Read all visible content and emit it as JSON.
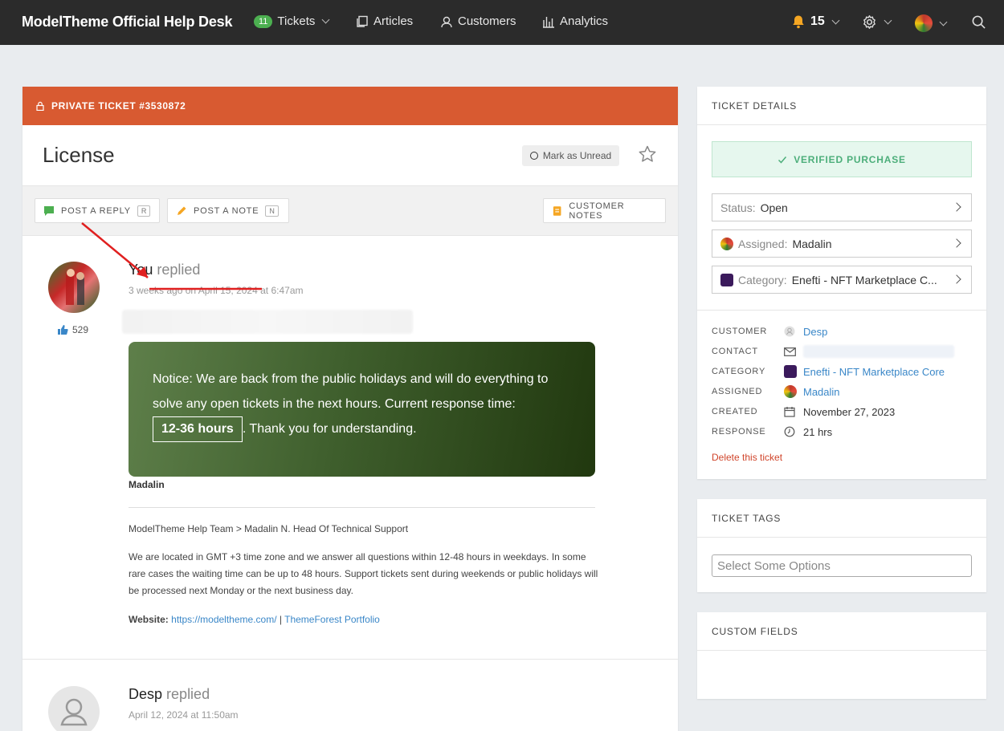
{
  "nav": {
    "brand": "ModelTheme Official Help Desk",
    "tickets_count": "11",
    "tickets_label": "Tickets",
    "articles_label": "Articles",
    "customers_label": "Customers",
    "analytics_label": "Analytics",
    "notifications_count": "15"
  },
  "ticket": {
    "private_label": "PRIVATE TICKET #3530872",
    "title": "License",
    "mark_unread_label": "Mark as Unread",
    "post_reply_label": "POST A REPLY",
    "post_reply_key": "R",
    "post_note_label": "POST A NOTE",
    "post_note_key": "N",
    "customer_notes_label": "CUSTOMER NOTES"
  },
  "replies": [
    {
      "author": "You",
      "action": "replied",
      "date": "3 weeks ago on April 15, 2024 at 6:47am",
      "likes": "529",
      "notice_text_1": "Notice: We are back from the public holidays and will do everything to solve any open tickets in the next hours. Current response time:",
      "notice_hours": "12-36 hours",
      "notice_text_2": ". Thank you for understanding.",
      "signature_name": "Madalin",
      "signature_team": "ModelTheme Help Team > Madalin N. Head Of Technical Support",
      "signature_body": "We are located in GMT +3 time zone and we answer all questions within 12-48 hours in weekdays. In some rare cases the waiting time can be up to 48 hours. Support tickets sent during weekends or public holidays will be processed next Monday or the next business day.",
      "website_label": "Website:",
      "website_link": "https://modeltheme.com/",
      "website_sep": "|",
      "portfolio_link": "ThemeForest Portfolio"
    },
    {
      "author": "Desp",
      "action": "replied",
      "date": "April 12, 2024 at 11:50am"
    }
  ],
  "details": {
    "header": "TICKET DETAILS",
    "verified_label": "VERIFIED PURCHASE",
    "status_label": "Status:",
    "status_value": "Open",
    "assigned_label": "Assigned:",
    "assigned_value": "Madalin",
    "category_label": "Category:",
    "category_value": "Enefti - NFT Marketplace C...",
    "meta": {
      "customer_label": "CUSTOMER",
      "customer_value": "Desp",
      "contact_label": "CONTACT",
      "category_label": "CATEGORY",
      "category_value": "Enefti - NFT Marketplace Core",
      "assigned_label": "ASSIGNED",
      "assigned_value": "Madalin",
      "created_label": "CREATED",
      "created_value": "November 27, 2023",
      "response_label": "RESPONSE",
      "response_value": "21 hrs"
    },
    "delete_label": "Delete this ticket"
  },
  "tags": {
    "header": "TICKET TAGS",
    "placeholder": "Select Some Options"
  },
  "custom_fields": {
    "header": "CUSTOM FIELDS"
  },
  "colors": {
    "ticket_bar": "#d85a31",
    "nav_bg": "#2b2b2b",
    "verified_green": "#4cae7a",
    "link_blue": "#3a87c8",
    "annotation_red": "#e02020"
  }
}
